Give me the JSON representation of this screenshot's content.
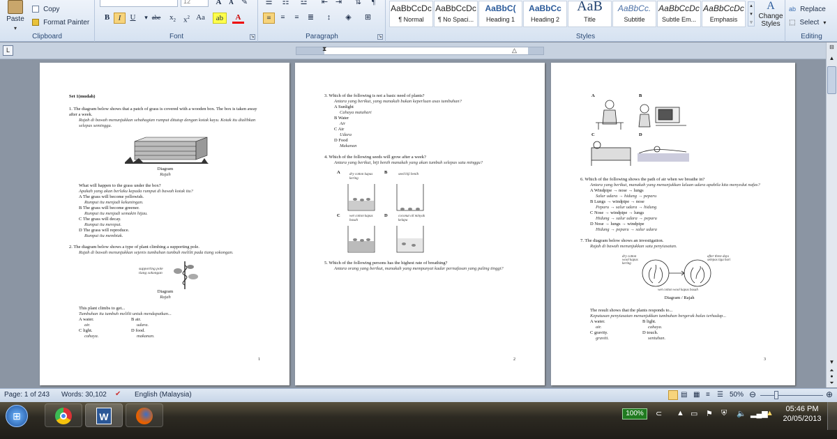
{
  "ribbon": {
    "clipboard": {
      "paste": "Paste",
      "copy": "Copy",
      "format_painter": "Format Painter",
      "label": "Clipboard"
    },
    "font": {
      "size": "12",
      "label": "Font"
    },
    "paragraph": {
      "label": "Paragraph"
    },
    "styles": {
      "label": "Styles",
      "items": [
        {
          "preview": "AaBbCcDc",
          "name": "¶ Normal"
        },
        {
          "preview": "AaBbCcDc",
          "name": "¶ No Spaci..."
        },
        {
          "preview": "AaBbC(",
          "name": "Heading 1"
        },
        {
          "preview": "AaBbCc",
          "name": "Heading 2"
        },
        {
          "preview": "AaB",
          "name": "Title"
        },
        {
          "preview": "AaBbCc.",
          "name": "Subtitle"
        },
        {
          "preview": "AaBbCcDc",
          "name": "Subtle Em..."
        },
        {
          "preview": "AaBbCcDc",
          "name": "Emphasis"
        }
      ],
      "change_styles": "Change Styles"
    },
    "editing": {
      "replace": "Replace",
      "select": "Select",
      "label": "Editing"
    }
  },
  "page1": {
    "set_title": "Set 1(mudah)",
    "q1": "1.   The diagram below shows that a patch of grass is covered with a wooden box. The box is taken away after a week.",
    "q1_ms": "Rajah di bawah menunjukkan sebahagian rumput ditutup dengan kotak kayu. Kotak itu dialihkan selepas seminggu.",
    "diagram": "Diagram",
    "rajah": "Rajah",
    "q1_ask": "What will happen to the grass under the box?",
    "q1_ask_ms": "Apakah yang akan berlaku kepada rumput di bawah kotak itu?",
    "q1_opts": [
      {
        "en": "A  The grass will become yellowish.",
        "ms": "Rumput itu menjadi kekuningan."
      },
      {
        "en": "B  The grass will become greener.",
        "ms": "Rumput itu menjadi semakin hijau."
      },
      {
        "en": "C  The grass will decay.",
        "ms": "Rumput itu mereput."
      },
      {
        "en": "D  The grass will reproduce.",
        "ms": "Rumput itu membiak."
      }
    ],
    "q2": "2.   The diagram below shows a type of plant climbing a supporting pole.",
    "q2_ms": "Rajah di bawah menunjukkan sejenis tumbuhan tumbuh melilit pada tiang sokongan.",
    "pole_label": "supporting pole tiang sokongan",
    "q2_ask": "This plant climbs to get...",
    "q2_ask_ms": "Tumbuhan itu tumbuh melilit untuk mendapatkan...",
    "q2_opts": [
      "A  water.",
      "B  air.",
      "air.",
      "udara.",
      "C  light.",
      "D  food.",
      "cahaya.",
      "makanan."
    ],
    "num": "1"
  },
  "page2": {
    "q3": "3.   Which of the following is not a basic need of plants?",
    "q3_ms": "Antara yang berikut, yang manakah bukan keperluan asas tumbuhan?",
    "q3_opts": [
      "A  Sunlight",
      "Cahaya matahari",
      "B  Water",
      "Air",
      "C  Air",
      "Udara",
      "D  Food",
      "Makanan"
    ],
    "q4": "4.   Which of the following seeds will grow after a week?",
    "q4_ms": "Antara yang berikut, biji benih manakah yang akan tumbuh selepas satu minggu?",
    "labels": {
      "a": "A",
      "b": "B",
      "c": "C",
      "d": "D",
      "a_text": "dry cotton kapas kering",
      "b_text": "seed biji benih",
      "c_text": "wet cotton kapas basah",
      "d_text": "coconut oil minyak kelapa"
    },
    "q5": "5.   Which of the following persons has the highest rate of breathing?",
    "q5_ms": "Antara orang yang berikut, manakah yang mempunyai kadar pernafasan yang paling tinggi?",
    "num": "2"
  },
  "page3": {
    "labels": {
      "a": "A",
      "b": "B",
      "c": "C",
      "d": "D"
    },
    "q6": "6.   Which of the following shows the path of air when we breathe in?",
    "q6_ms": "Antara yang berikut, manakah yang menunjukkan laluan udara apabila kita menyedut nafas?",
    "q6_opts": [
      "A  Windpipe → nose → lungs",
      "Salur udara → hidung → peparu",
      "B  Lungs → windpipe → nose",
      "Peparu → salur udara → hidung",
      "C  Nose → windpipe → lungs",
      "Hidung → salur udara → peparu",
      "D  Nose → lungs → windpipe",
      "Hidung → peparu → salur udara"
    ],
    "q7": "7.   The diagram below shows an investigation.",
    "q7_ms": "Rajah di bawah menunjukkan satu penyiasatan.",
    "fig_dry": "dry cotton wool kapas kering",
    "fig_after": "after three days selepas tiga hari",
    "fig_wet": "wet cotton wool kapas basah",
    "fig_caption": "Diagram / Rajah",
    "q7_ask": "The result shows that the plants responds to...",
    "q7_ask_ms": "Keputusan penyiasatan menunjukkan tumbuhan bergerak balas terhadap...",
    "q7_opts": [
      "A  water.",
      "B  light.",
      "air.",
      "cahaya.",
      "C  gravity.",
      "D  touch.",
      "graviti.",
      "sentuhan."
    ],
    "num": "3"
  },
  "status": {
    "page": "Page: 1 of 243",
    "words": "Words: 30,102",
    "language": "English (Malaysia)",
    "zoom": "50%"
  },
  "taskbar": {
    "battery": "100%",
    "time": "05:46 PM",
    "date": "20/05/2013"
  }
}
